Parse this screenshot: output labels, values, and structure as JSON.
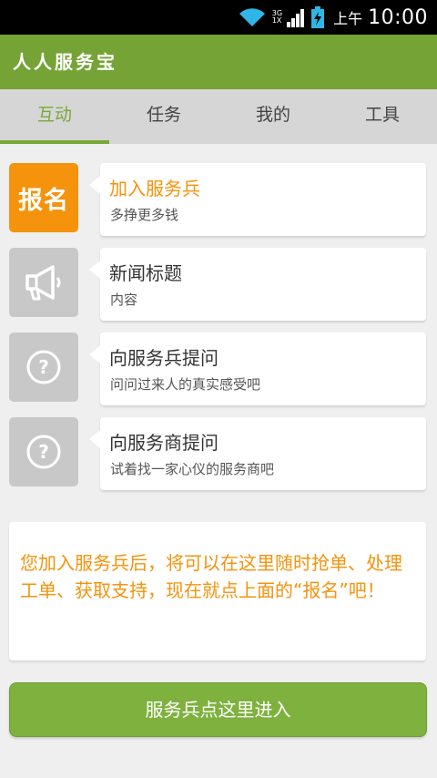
{
  "status_bar": {
    "network_top": "3G",
    "network_bottom": "1X",
    "ampm": "上午",
    "time": "10:00",
    "icons": [
      "wifi-icon",
      "signal-icon",
      "battery-charging-icon"
    ]
  },
  "app": {
    "title": "人人服务宝"
  },
  "tabs": [
    {
      "label": "互动",
      "active": true
    },
    {
      "label": "任务",
      "active": false
    },
    {
      "label": "我的",
      "active": false
    },
    {
      "label": "工具",
      "active": false
    }
  ],
  "items": [
    {
      "thumb_text": "报名",
      "title": "加入服务兵",
      "subtitle": "多挣更多钱",
      "icon": "signup-badge"
    },
    {
      "title": "新闻标题",
      "subtitle": "内容",
      "icon": "megaphone-icon"
    },
    {
      "title": "向服务兵提问",
      "subtitle": "问问过来人的真实感受吧",
      "icon": "question-icon"
    },
    {
      "title": "向服务商提问",
      "subtitle": "试着找一家心仪的服务商吧",
      "icon": "question-icon"
    }
  ],
  "notice": {
    "text": "您加入服务兵后，将可以在这里随时抢单、处理工单、获取支持，现在就点上面的“报名”吧！"
  },
  "enter_button": {
    "label": "服务兵点这里进入"
  },
  "colors": {
    "green": "#76a336",
    "orange": "#f5930c",
    "tab_bg": "#d6d6d6"
  }
}
